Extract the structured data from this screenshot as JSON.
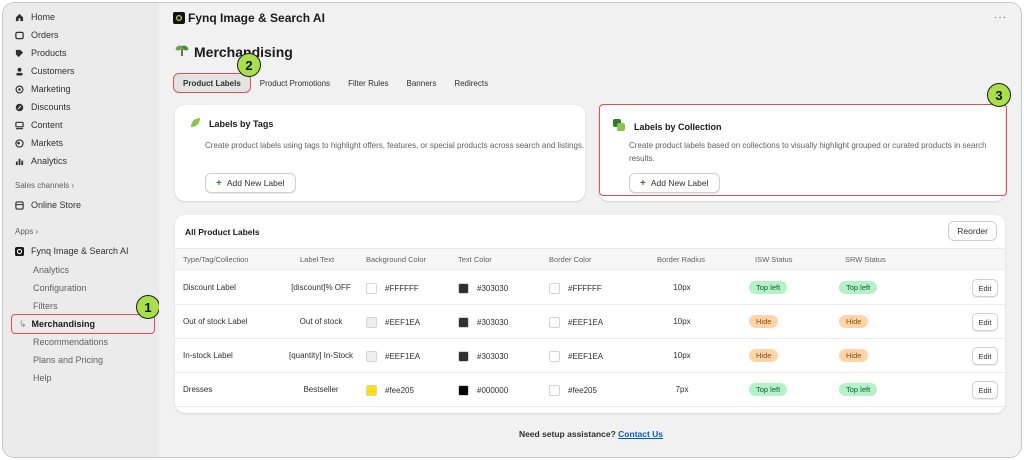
{
  "sidebar": {
    "items": [
      {
        "label": "Home",
        "icon": "home-icon"
      },
      {
        "label": "Orders",
        "icon": "orders-icon"
      },
      {
        "label": "Products",
        "icon": "tag-icon"
      },
      {
        "label": "Customers",
        "icon": "person-icon"
      },
      {
        "label": "Marketing",
        "icon": "target-icon"
      },
      {
        "label": "Discounts",
        "icon": "discount-icon"
      },
      {
        "label": "Content",
        "icon": "content-icon"
      },
      {
        "label": "Markets",
        "icon": "globe-icon"
      },
      {
        "label": "Analytics",
        "icon": "bar-chart-icon"
      }
    ],
    "sales_channels_label": "Sales channels",
    "online_store": "Online Store",
    "apps_label": "Apps",
    "app_name": "Fynq Image & Search AI",
    "app_subitems": [
      "Analytics",
      "Configuration",
      "Filters",
      "Merchandising",
      "Recommendations",
      "Plans and Pricing",
      "Help"
    ]
  },
  "appbar": {
    "title": "Fynq Image & Search AI",
    "more": "···"
  },
  "page": {
    "title": "Merchandising"
  },
  "tabs": [
    "Product Labels",
    "Product Promotions",
    "Filter Rules",
    "Banners",
    "Redirects"
  ],
  "cards": {
    "tags": {
      "title": "Labels by Tags",
      "desc": "Create product labels using tags to highlight offers, features, or special products across search and listings.",
      "button": "Add New Label"
    },
    "collection": {
      "title": "Labels by Collection",
      "desc": "Create product labels based on collections to visually highlight grouped or curated products in search results.",
      "button": "Add New Label"
    }
  },
  "table": {
    "title": "All Product Labels",
    "reorder": "Reorder",
    "headers": [
      "Type/Tag/Collection",
      "Label Text",
      "Background Color",
      "Text Color",
      "Border Color",
      "Border Radius",
      "ISW Status",
      "SRW Status"
    ],
    "rows": [
      {
        "type": "Discount Label",
        "text": "[discount]% OFF",
        "bg": "#FFFFFF",
        "fg": "#303030",
        "border": "#FFFFFF",
        "radius": "10px",
        "isw": "Top left",
        "srw": "Top left",
        "isw_tone": "green",
        "srw_tone": "green",
        "bg_swatch": "#FFFFFF",
        "fg_swatch": "#303030",
        "border_swatch": "#FFFFFF"
      },
      {
        "type": "Out of stock Label",
        "text": "Out of stock",
        "bg": "#EEF1EA",
        "fg": "#303030",
        "border": "#EEF1EA",
        "radius": "10px",
        "isw": "Hide",
        "srw": "Hide",
        "isw_tone": "orange",
        "srw_tone": "orange",
        "bg_swatch": "#EEF1EA",
        "fg_swatch": "#303030",
        "border_swatch": "#FFFFFF"
      },
      {
        "type": "In-stock Label",
        "text": "[quantity] In-Stock",
        "bg": "#EEF1EA",
        "fg": "#303030",
        "border": "#EEF1EA",
        "radius": "10px",
        "isw": "Hide",
        "srw": "Hide",
        "isw_tone": "orange",
        "srw_tone": "orange",
        "bg_swatch": "#EEF1EA",
        "fg_swatch": "#303030",
        "border_swatch": "#FFFFFF"
      },
      {
        "type": "Dresses",
        "text": "Bestseller",
        "bg": "#fee205",
        "fg": "#000000",
        "border": "#fee205",
        "radius": "7px",
        "isw": "Top left",
        "srw": "Top left",
        "isw_tone": "green",
        "srw_tone": "green",
        "bg_swatch": "#fee205",
        "fg_swatch": "#000000",
        "border_swatch": "#FFFFFF"
      }
    ],
    "edit_label": "Edit"
  },
  "footer": {
    "text": "Need setup assistance?",
    "link": "Contact Us"
  },
  "markers": [
    "1",
    "2",
    "3"
  ],
  "colors": {
    "accent_red": "#e4505a",
    "marker_green": "#a8e04a",
    "link_blue": "#005bd3"
  }
}
